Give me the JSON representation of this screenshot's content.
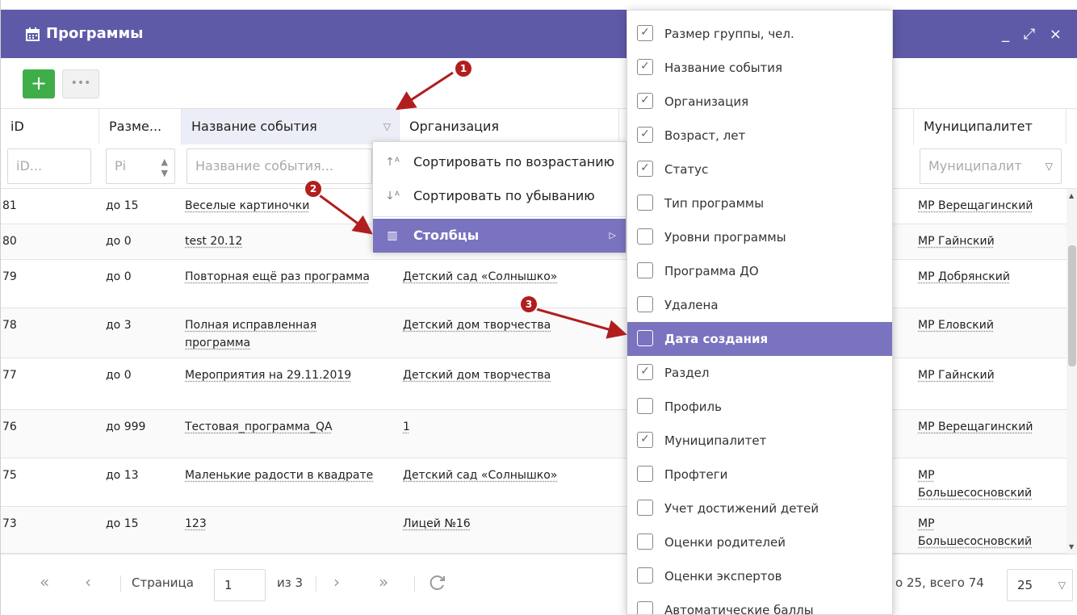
{
  "window": {
    "title": "Программы",
    "controls": "_ ⤢ ×"
  },
  "toolbar": {
    "add_label": "+",
    "more_label": "•••"
  },
  "columns": [
    {
      "key": "id",
      "label": "iD",
      "filter": "iD..."
    },
    {
      "key": "size",
      "label": "Разме...",
      "filter": "Рі"
    },
    {
      "key": "name",
      "label": "Название события",
      "filter": "Название события..."
    },
    {
      "key": "org",
      "label": "Организация",
      "filter": ""
    },
    {
      "key": "muni",
      "label": "Муниципалитет",
      "filter": "Муниципалит"
    }
  ],
  "rows": [
    {
      "id": "81",
      "size": "до 15",
      "name": "Веселые картиночки",
      "org": "",
      "muni": "МР Верещагинский"
    },
    {
      "id": "80",
      "size": "до 0",
      "name": "test 20.12",
      "org": "",
      "muni": "МР Гайнский"
    },
    {
      "id": "79",
      "size": "до 0",
      "name": "Повторная ещё раз программа",
      "org": "Детский сад «Солнышко»",
      "muni": "МР Добрянский"
    },
    {
      "id": "78",
      "size": "до 3",
      "name": "Полная исправленная программа",
      "org": "Детский дом творчества",
      "muni": "МР Еловский"
    },
    {
      "id": "77",
      "size": "до 0",
      "name": "Мероприятия на 29.11.2019",
      "org": "Детский дом творчества",
      "muni": "МР Гайнский"
    },
    {
      "id": "76",
      "size": "до 999",
      "name": "Тестовая_программа_QA",
      "org": "1",
      "muni": "МР Верещагинский"
    },
    {
      "id": "75",
      "size": "до 13",
      "name": "Маленькие радости в квадрате",
      "org": "Детский сад «Солнышко»",
      "muni": "МР Большесосновский"
    },
    {
      "id": "73",
      "size": "до 15",
      "name": "123",
      "org": "Лицей №16",
      "muni": "МР Большесосновский"
    }
  ],
  "context_menu": {
    "sort_asc": "Сортировать по возрастанию",
    "sort_desc": "Сортировать по убыванию",
    "columns": "Столбцы"
  },
  "column_menu": [
    {
      "label": "Размер группы, чел.",
      "checked": true
    },
    {
      "label": "Название события",
      "checked": true
    },
    {
      "label": "Организация",
      "checked": true
    },
    {
      "label": "Возраст, лет",
      "checked": true
    },
    {
      "label": "Статус",
      "checked": true
    },
    {
      "label": "Тип программы",
      "checked": false
    },
    {
      "label": "Уровни программы",
      "checked": false
    },
    {
      "label": "Программа ДО",
      "checked": false
    },
    {
      "label": "Удалена",
      "checked": false
    },
    {
      "label": "Дата создания",
      "checked": false,
      "active": true
    },
    {
      "label": "Раздел",
      "checked": true
    },
    {
      "label": "Профиль",
      "checked": false
    },
    {
      "label": "Муниципалитет",
      "checked": true
    },
    {
      "label": "Профтеги",
      "checked": false
    },
    {
      "label": "Учет достижений детей",
      "checked": false
    },
    {
      "label": "Оценки родителей",
      "checked": false
    },
    {
      "label": "Оценки экспертов",
      "checked": false
    },
    {
      "label": "Автоматические баллы",
      "checked": false
    }
  ],
  "pager": {
    "page_label": "Страница",
    "page_value": "1",
    "of_label": "из 3",
    "info": "о 25, всего 74",
    "page_size": "25"
  },
  "markers": [
    "1",
    "2",
    "3"
  ],
  "colors": {
    "accent": "#5f5aa8",
    "menu_active": "#7a73bf",
    "add_button": "#3fae49",
    "marker": "#b11e1e"
  }
}
